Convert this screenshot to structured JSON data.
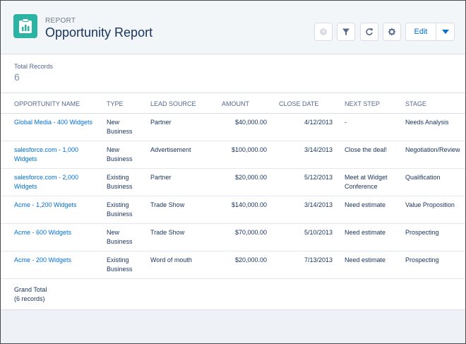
{
  "header": {
    "eyebrow": "REPORT",
    "title": "Opportunity Report",
    "edit_label": "Edit",
    "icons": [
      "report-icon",
      "clock-icon",
      "filter-icon",
      "refresh-icon",
      "gear-icon",
      "chevron-down-icon"
    ]
  },
  "summary": {
    "total_label": "Total Records",
    "total_value": "6"
  },
  "table": {
    "columns": [
      "OPPORTUNITY NAME",
      "TYPE",
      "LEAD SOURCE",
      "AMOUNT",
      "CLOSE DATE",
      "NEXT STEP",
      "STAGE"
    ],
    "rows": [
      {
        "name": [
          "Global Media - 400 Widgets"
        ],
        "type": [
          "New",
          "Business"
        ],
        "lead": "Partner",
        "amount": "$40,000.00",
        "date": "4/12/2013",
        "next": [
          "-"
        ],
        "stage": "Needs Analysis"
      },
      {
        "name": [
          "salesforce.com - 1,000",
          "Widgets"
        ],
        "type": [
          "New",
          "Business"
        ],
        "lead": "Advertisement",
        "amount": "$100,000.00",
        "date": "3/14/2013",
        "next": [
          "Close the deal!"
        ],
        "stage": "Negotiation/Review"
      },
      {
        "name": [
          "salesforce.com - 2,000",
          "Widgets"
        ],
        "type": [
          "Existing",
          "Business"
        ],
        "lead": "Partner",
        "amount": "$20,000.00",
        "date": "5/12/2013",
        "next": [
          "Meet at Widget",
          "Conference"
        ],
        "stage": "Qualification"
      },
      {
        "name": [
          "Acme - 1,200 Widgets"
        ],
        "type": [
          "Existing",
          "Business"
        ],
        "lead": "Trade Show",
        "amount": "$140,000.00",
        "date": "3/14/2013",
        "next": [
          "Need estimate"
        ],
        "stage": "Value Proposition"
      },
      {
        "name": [
          "Acme - 600 Widgets"
        ],
        "type": [
          "New",
          "Business"
        ],
        "lead": "Trade Show",
        "amount": "$70,000.00",
        "date": "5/10/2013",
        "next": [
          "Need estimate"
        ],
        "stage": "Prospecting"
      },
      {
        "name": [
          "Acme - 200 Widgets"
        ],
        "type": [
          "Existing",
          "Business"
        ],
        "lead": "Word of mouth",
        "amount": "$20,000.00",
        "date": "7/13/2013",
        "next": [
          "Need estimate"
        ],
        "stage": "Prospecting"
      }
    ],
    "grand_total": [
      "Grand Total",
      "(6 records)"
    ]
  },
  "colors": {
    "accent": "#0070d2",
    "report_icon": "#2bb3a4",
    "title_text": "#16325c"
  }
}
